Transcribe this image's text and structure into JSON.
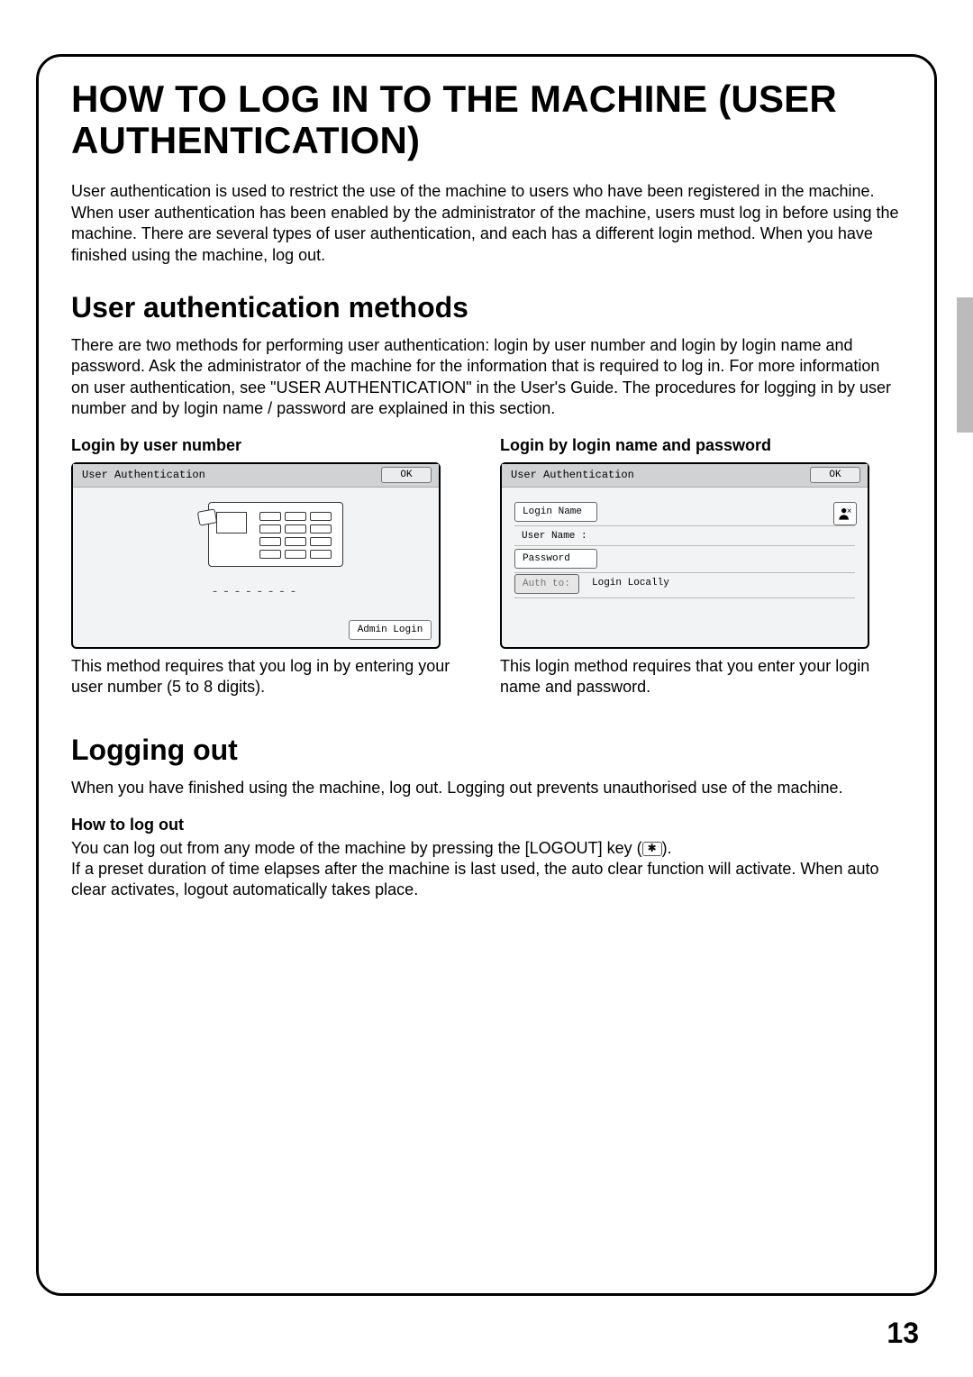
{
  "title": "HOW TO LOG IN TO THE MACHINE (USER AUTHENTICATION)",
  "intro": "User authentication is used to restrict the use of the machine to users who have been registered in the machine. When user authentication has been enabled by the administrator of the machine, users must log in before using the machine. There are several types of user authentication, and each has a different login method. When you have finished using the machine, log out.",
  "section1": {
    "heading": "User authentication methods",
    "body": "There are two methods for performing user authentication: login by user number and login by login name and password. Ask the administrator of the machine for the information that is required to log in. For more information on user authentication, see \"USER AUTHENTICATION\" in the User's Guide. The procedures for logging in by user number and by login name / password are explained in this section."
  },
  "methods": {
    "left": {
      "title": "Login by user number",
      "panel_title": "User Authentication",
      "ok": "OK",
      "dashes": "--------",
      "admin": "Admin Login",
      "caption": "This method requires that you log in by entering your user number (5 to 8 digits)."
    },
    "right": {
      "title": "Login by login name and password",
      "panel_title": "User Authentication",
      "ok": "OK",
      "login_name": "Login Name",
      "user_name_label": "User Name   :",
      "password": "Password",
      "auth_to": "Auth to:",
      "auth_val": "Login Locally",
      "caption": "This login method requires that you enter your login name and password."
    }
  },
  "section2": {
    "heading": "Logging out",
    "body": "When you have finished using the machine, log out. Logging out prevents unauthorised use of the machine.",
    "sub": "How to log out",
    "para1a": "You can log out from any mode of the machine by pressing the [LOGOUT] key (",
    "para1b": ").",
    "para2": "If a preset duration of time elapses after the machine is last used, the auto clear function will activate. When auto clear activates, logout automatically takes place."
  },
  "logout_key_glyph": "✱",
  "page_number": "13"
}
